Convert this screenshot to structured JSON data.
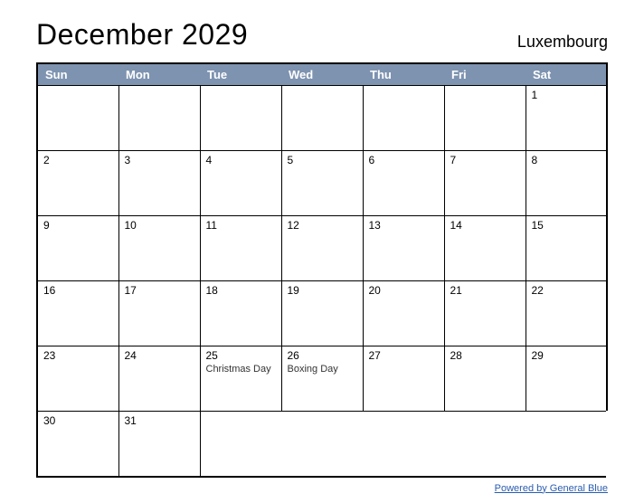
{
  "title": "December 2029",
  "region": "Luxembourg",
  "days": [
    "Sun",
    "Mon",
    "Tue",
    "Wed",
    "Thu",
    "Fri",
    "Sat"
  ],
  "weeks": [
    [
      {
        "n": ""
      },
      {
        "n": ""
      },
      {
        "n": ""
      },
      {
        "n": ""
      },
      {
        "n": ""
      },
      {
        "n": ""
      },
      {
        "n": "1"
      }
    ],
    [
      {
        "n": "2"
      },
      {
        "n": "3"
      },
      {
        "n": "4"
      },
      {
        "n": "5"
      },
      {
        "n": "6"
      },
      {
        "n": "7"
      },
      {
        "n": "8"
      }
    ],
    [
      {
        "n": "9"
      },
      {
        "n": "10"
      },
      {
        "n": "11"
      },
      {
        "n": "12"
      },
      {
        "n": "13"
      },
      {
        "n": "14"
      },
      {
        "n": "15"
      }
    ],
    [
      {
        "n": "16"
      },
      {
        "n": "17"
      },
      {
        "n": "18"
      },
      {
        "n": "19"
      },
      {
        "n": "20"
      },
      {
        "n": "21"
      },
      {
        "n": "22"
      }
    ],
    [
      {
        "n": "23"
      },
      {
        "n": "24"
      },
      {
        "n": "25",
        "e": "Christmas Day"
      },
      {
        "n": "26",
        "e": "Boxing Day"
      },
      {
        "n": "27"
      },
      {
        "n": "28"
      },
      {
        "n": "29"
      }
    ],
    [
      {
        "n": "30"
      },
      {
        "n": "31"
      },
      {
        "n": ""
      },
      {
        "n": ""
      },
      {
        "n": ""
      },
      {
        "n": ""
      },
      {
        "n": ""
      }
    ]
  ],
  "footer": "Powered by General Blue"
}
